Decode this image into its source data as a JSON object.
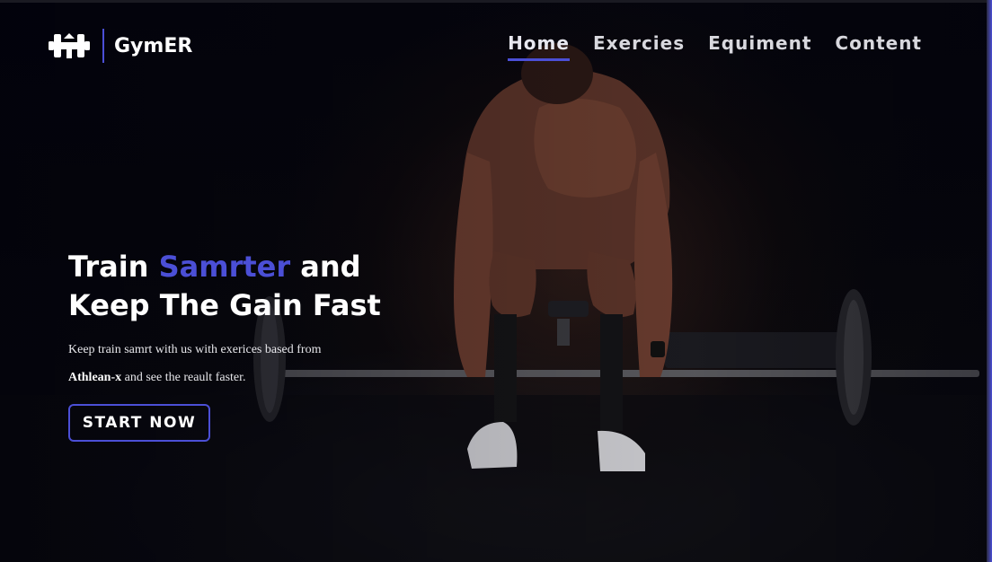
{
  "brand": {
    "name": "GymER",
    "logo_icon": "dumbbell-icon",
    "accent_color": "#4b4fd6"
  },
  "nav": {
    "items": [
      {
        "label": "Home",
        "active": true
      },
      {
        "label": "Exercies",
        "active": false
      },
      {
        "label": "Equiment",
        "active": false
      },
      {
        "label": "Content",
        "active": false
      }
    ]
  },
  "hero": {
    "title_part1": "Train ",
    "title_accent": "Samrter",
    "title_part2": " and Keep The Gain Fast",
    "desc_part1": "Keep train samrt with us with exerices based from ",
    "desc_bold": "Athlean-x",
    "desc_part2": " and see the reault faster.",
    "cta_label": "START NOW"
  }
}
